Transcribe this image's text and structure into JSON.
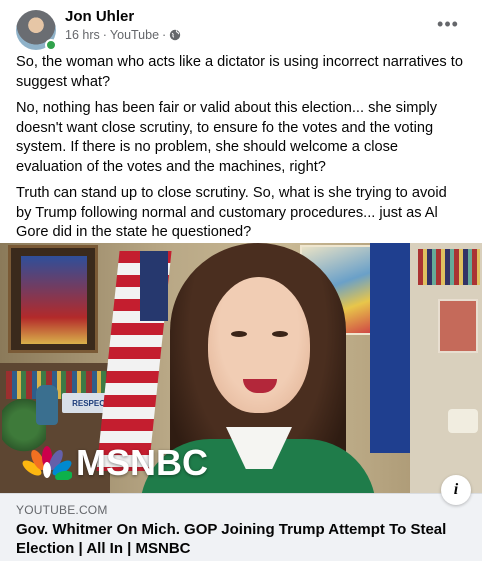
{
  "post": {
    "author": "Jon Uhler",
    "time": "16 hrs",
    "via": "YouTube",
    "separator": "·",
    "privacy_icon": "globe-icon",
    "more_label": "•••",
    "paragraphs": [
      "So, the woman who acts like a dictator is using incorrect narratives to suggest what?",
      "No, nothing has been fair or valid about this election... she simply doesn't want close scrutiny, to ensure fo the votes and the voting system. If there is no problem, she should welcome a close evaluation of the votes and the machines, right?",
      "Truth can stand up to close scrutiny. So, what is she trying to avoid by Trump following normal and customary procedures... just as Al Gore did in the state he questioned?"
    ]
  },
  "media": {
    "logo_text": "MSNBC",
    "sign_text": "RESPECT"
  },
  "link": {
    "domain": "YOUTUBE.COM",
    "title": "Gov. Whitmer On Mich. GOP Joining Trump Attempt To Steal Election | All In | MSNBC",
    "info_label": "i"
  },
  "colors": {
    "online_badge": "#31a24c",
    "secondary_text": "#65676b",
    "card_bg": "#f0f2f5",
    "shirt": "#1f7c4a"
  }
}
